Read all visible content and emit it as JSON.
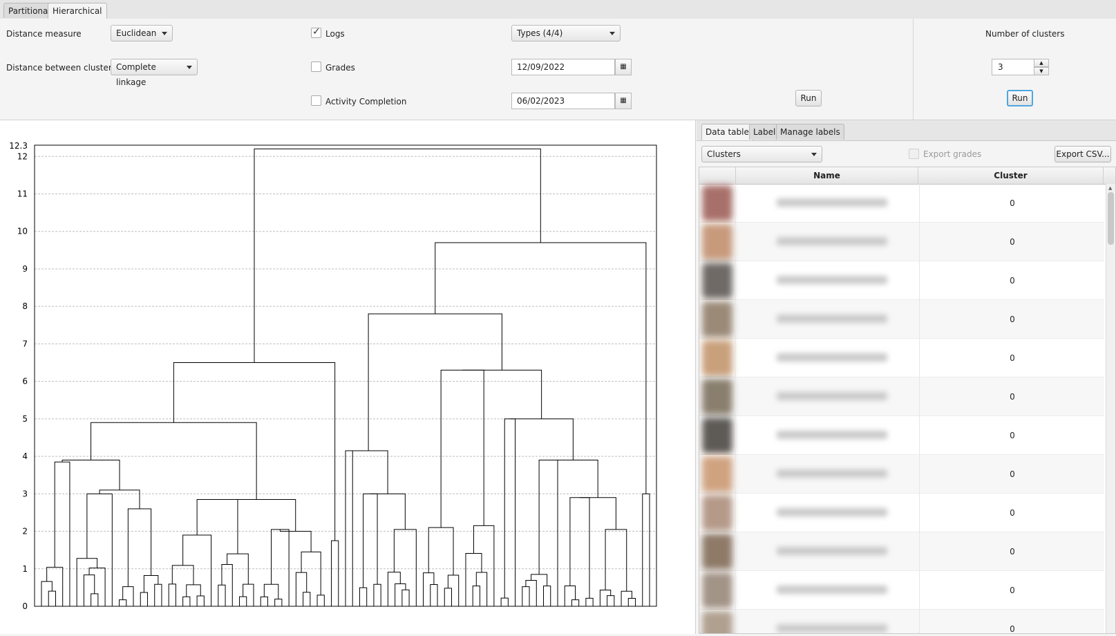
{
  "tabs": [
    {
      "label": "Partitional",
      "active": false
    },
    {
      "label": "Hierarchical",
      "active": true
    }
  ],
  "controls": {
    "distance_measure_label": "Distance measure",
    "distance_measure_value": "Euclidean",
    "distance_between_label": "Distance between clusters",
    "distance_between_value": "Complete linkage",
    "logs_label": "Logs",
    "logs_checked": true,
    "grades_label": "Grades",
    "grades_checked": false,
    "activity_label": "Activity Completion",
    "activity_checked": false,
    "types_value": "Types (4/4)",
    "start_date": "12/09/2022",
    "end_date": "06/02/2023",
    "run_label": "Run"
  },
  "clusters_panel": {
    "title": "Number of clusters",
    "value": "3",
    "run_label": "Run"
  },
  "right_tabs": [
    "Data table",
    "Label",
    "Manage labels"
  ],
  "table_controls": {
    "view_select": "Clusters",
    "export_grades_label": "Export grades",
    "export_csv_label": "Export CSV..."
  },
  "table": {
    "columns": [
      "Name",
      "Cluster"
    ],
    "rows": [
      {
        "cluster": "0"
      },
      {
        "cluster": "0"
      },
      {
        "cluster": "0"
      },
      {
        "cluster": "0"
      },
      {
        "cluster": "0"
      },
      {
        "cluster": "0"
      },
      {
        "cluster": "0"
      },
      {
        "cluster": "0"
      },
      {
        "cluster": "0"
      },
      {
        "cluster": "0"
      },
      {
        "cluster": "0"
      },
      {
        "cluster": "0"
      }
    ]
  },
  "chart_data": {
    "type": "dendrogram",
    "y_ticks": [
      "0",
      "1",
      "2",
      "3",
      "4",
      "5",
      "6",
      "7",
      "8",
      "9",
      "10",
      "11",
      "12"
    ],
    "y_max_label": "12.3",
    "ylim": [
      0,
      12.3
    ],
    "grid": true,
    "top_merges": [
      {
        "height": 12.2,
        "note": "root"
      },
      {
        "height": 9.7
      },
      {
        "height": 7.8
      },
      {
        "height": 6.5
      },
      {
        "height": 6.3
      },
      {
        "height": 5.0
      },
      {
        "height": 4.9
      },
      {
        "height": 4.15
      },
      {
        "height": 3.9
      },
      {
        "height": 3.85
      },
      {
        "height": 3.0
      }
    ]
  }
}
